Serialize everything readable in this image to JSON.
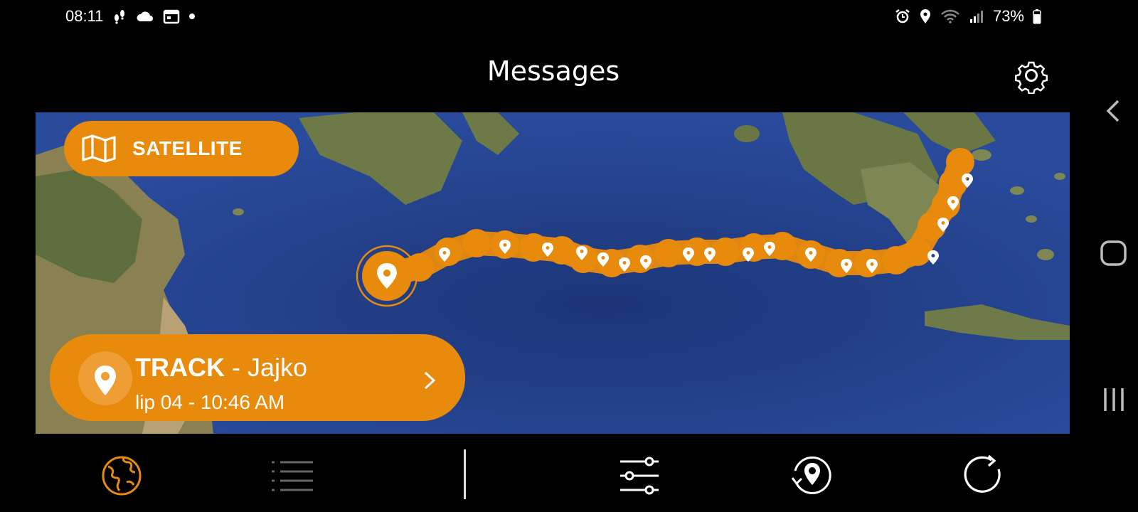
{
  "status_bar": {
    "time": "08:11",
    "battery": "73%",
    "left_icons": [
      "footsteps-icon",
      "cloud-icon",
      "calendar-icon",
      "dot-icon"
    ],
    "right_icons": [
      "alarm-icon",
      "location-icon",
      "wifi-icon",
      "signal-icon",
      "battery-icon"
    ]
  },
  "header": {
    "title": "Messages",
    "settings_icon": "gear-icon"
  },
  "map": {
    "satellite_label": "SATELLITE",
    "satellite_icon": "map-icon",
    "track": {
      "type": "TRACK",
      "separator": " - ",
      "device": "Jajko",
      "date": "lip 04 - 10:46 AM"
    }
  },
  "bottom_nav": {
    "items": [
      {
        "icon": "globe-icon",
        "active": true
      },
      {
        "icon": "list-icon",
        "active": false
      },
      {
        "icon": "filter-sliders-icon",
        "active": false
      },
      {
        "icon": "locate-history-icon",
        "active": false
      },
      {
        "icon": "refresh-icon",
        "active": false
      }
    ]
  },
  "system_nav": [
    "back-icon",
    "home-icon",
    "recents-icon"
  ],
  "colors": {
    "accent": "#e88a0c",
    "background": "#000000",
    "sea": "#22418f",
    "land": "#6b7a4a"
  }
}
